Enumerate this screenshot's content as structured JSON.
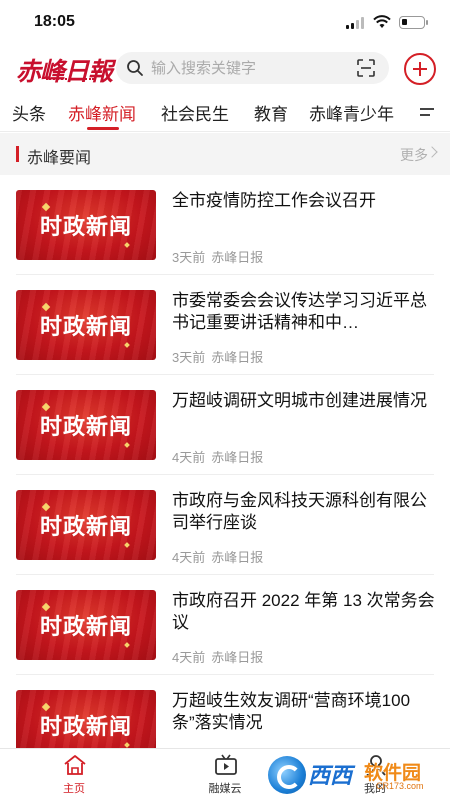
{
  "status_bar": {
    "time": "18:05",
    "battery_level": 0.25
  },
  "header": {
    "logo_text": "赤峰日報",
    "search": {
      "placeholder": "输入搜索关键字"
    },
    "icons": {
      "search": "search-icon",
      "scan": "scan-icon",
      "add": "plus-circle-icon"
    }
  },
  "tabs": [
    {
      "label": "头条",
      "active": false
    },
    {
      "label": "赤峰新闻",
      "active": true
    },
    {
      "label": "社会民生",
      "active": false
    },
    {
      "label": "教育",
      "active": false
    },
    {
      "label": "赤峰青少年",
      "active": false
    }
  ],
  "section": {
    "title": "赤峰要闻",
    "more_label": "更多"
  },
  "news": [
    {
      "thumb_text": "时政新闻",
      "title": "全市疫情防控工作会议召开",
      "time": "3天前",
      "source": "赤峰日报"
    },
    {
      "thumb_text": "时政新闻",
      "title": "市委常委会会议传达学习习近平总书记重要讲话精神和中…",
      "time": "3天前",
      "source": "赤峰日报"
    },
    {
      "thumb_text": "时政新闻",
      "title": "万超岐调研文明城市创建进展情况",
      "time": "4天前",
      "source": "赤峰日报"
    },
    {
      "thumb_text": "时政新闻",
      "title": "市政府与金风科技天源科创有限公司举行座谈",
      "time": "4天前",
      "source": "赤峰日报"
    },
    {
      "thumb_text": "时政新闻",
      "title": "市政府召开 2022 年第 13 次常务会议",
      "time": "4天前",
      "source": "赤峰日报"
    },
    {
      "thumb_text": "时政新闻",
      "title": "万超岐生效友调研“营商环境100条”落实情况",
      "time": "",
      "source": ""
    }
  ],
  "bottom_nav": [
    {
      "label": "主页",
      "icon": "home-icon",
      "active": true
    },
    {
      "label": "融媒云",
      "icon": "video-icon",
      "active": false
    },
    {
      "label": "我的",
      "icon": "user-icon",
      "active": false
    }
  ],
  "watermark": {
    "text1": "西西",
    "text2": "软件园",
    "url": "CR173.com"
  },
  "colors": {
    "accent": "#d41f26",
    "thumb_red": "#c8161d",
    "muted": "#9a9a9a"
  }
}
